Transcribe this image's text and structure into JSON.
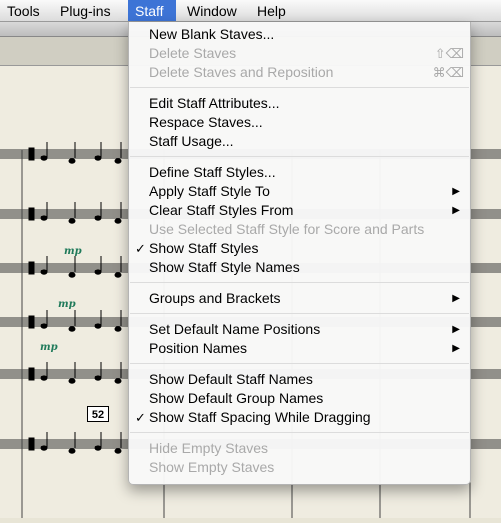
{
  "menubar": {
    "items": [
      "Tools",
      "Plug-ins",
      "Staff",
      "Window",
      "Help"
    ],
    "active": "Staff"
  },
  "score": {
    "measure_number": "52",
    "dynamic_mark": "mp"
  },
  "menu": {
    "groups": [
      [
        {
          "label": "New Blank Staves...",
          "enabled": true
        },
        {
          "label": "Delete Staves",
          "enabled": false,
          "shortcut": "⇧⌫"
        },
        {
          "label": "Delete Staves and Reposition",
          "enabled": false,
          "shortcut": "⌘⌫"
        }
      ],
      [
        {
          "label": "Edit Staff Attributes...",
          "enabled": true
        },
        {
          "label": "Respace Staves...",
          "enabled": true
        },
        {
          "label": "Staff Usage...",
          "enabled": true
        }
      ],
      [
        {
          "label": "Define Staff Styles...",
          "enabled": true
        },
        {
          "label": "Apply Staff Style To",
          "enabled": true,
          "submenu": true
        },
        {
          "label": "Clear Staff Styles From",
          "enabled": true,
          "submenu": true
        },
        {
          "label": "Use Selected Staff Style for Score and Parts",
          "enabled": false
        },
        {
          "label": "Show Staff Styles",
          "enabled": true,
          "checked": true
        },
        {
          "label": "Show Staff Style Names",
          "enabled": true
        }
      ],
      [
        {
          "label": "Groups and Brackets",
          "enabled": true,
          "submenu": true
        }
      ],
      [
        {
          "label": "Set Default Name Positions",
          "enabled": true,
          "submenu": true
        },
        {
          "label": "Position Names",
          "enabled": true,
          "submenu": true
        }
      ],
      [
        {
          "label": "Show Default Staff Names",
          "enabled": true
        },
        {
          "label": "Show Default Group Names",
          "enabled": true
        },
        {
          "label": "Show Staff Spacing While Dragging",
          "enabled": true,
          "checked": true
        }
      ],
      [
        {
          "label": "Hide Empty Staves",
          "enabled": false
        },
        {
          "label": "Show Empty Staves",
          "enabled": false
        }
      ]
    ],
    "check_glyph": "✓",
    "submenu_glyph": "▶"
  },
  "colors": {
    "highlight": "#3d74d6",
    "disabled_text": "#a9a9a9",
    "dynamic_green": "#1f7a5a"
  }
}
